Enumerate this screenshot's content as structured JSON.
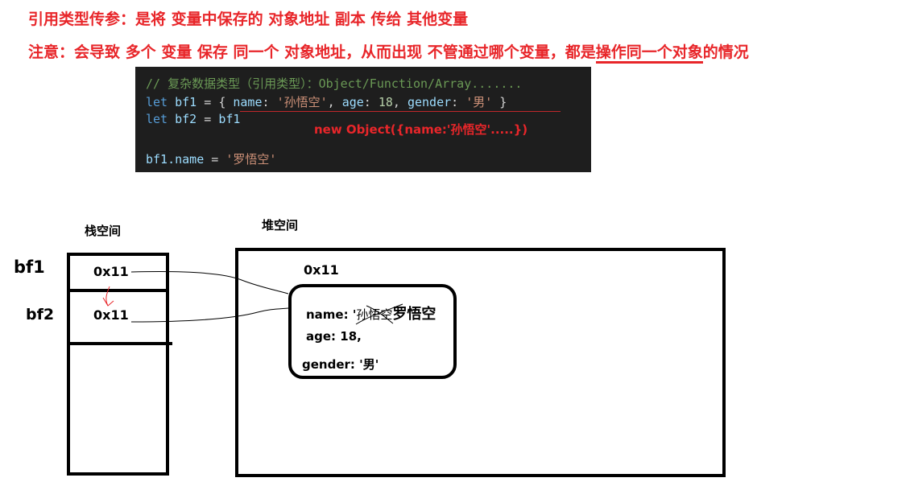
{
  "heading": {
    "line1": "引用类型传参：是将 变量中保存的 对象地址 副本 传给 其他变量",
    "line2_before": "注意：会导致 多个 变量 保存 同一个 对象地址，从而出现 不管通过哪个变量，都是",
    "line2_underlined": "操作同一个对象",
    "line2_after": "的情况"
  },
  "code": {
    "comment": "// 复杂数据类型（引用类型）：Object/Function/Array.......",
    "line2": {
      "kw": "let",
      "var": "bf1",
      "eq": " = ",
      "open": "{ ",
      "k1": "name",
      "v1": "'孙悟空'",
      "k2": "age",
      "v2": "18",
      "k3": "gender",
      "v3": "'男'",
      "close": " }"
    },
    "line3": {
      "kw": "let",
      "var": "bf2",
      "eq": " = ",
      "val": "bf1"
    },
    "line5": {
      "obj": "bf1",
      "prop": ".name",
      "eq": " = ",
      "val": "'罗悟空'"
    },
    "annotation": "new Object({name:'孙悟空'.....})"
  },
  "stack": {
    "label": "栈空间",
    "vars": [
      {
        "name": "bf1",
        "value": "0x11"
      },
      {
        "name": "bf2",
        "value": "0x11"
      }
    ]
  },
  "heap": {
    "label": "堆空间",
    "address": "0x11",
    "object": {
      "name_label": "name: '",
      "old_name": "孙悟空",
      "new_name": "罗悟空",
      "age": "age: 18,",
      "gender": "gender: '男'"
    }
  },
  "colors": {
    "accent": "#e8262a",
    "code_bg": "#1e1e1e"
  }
}
